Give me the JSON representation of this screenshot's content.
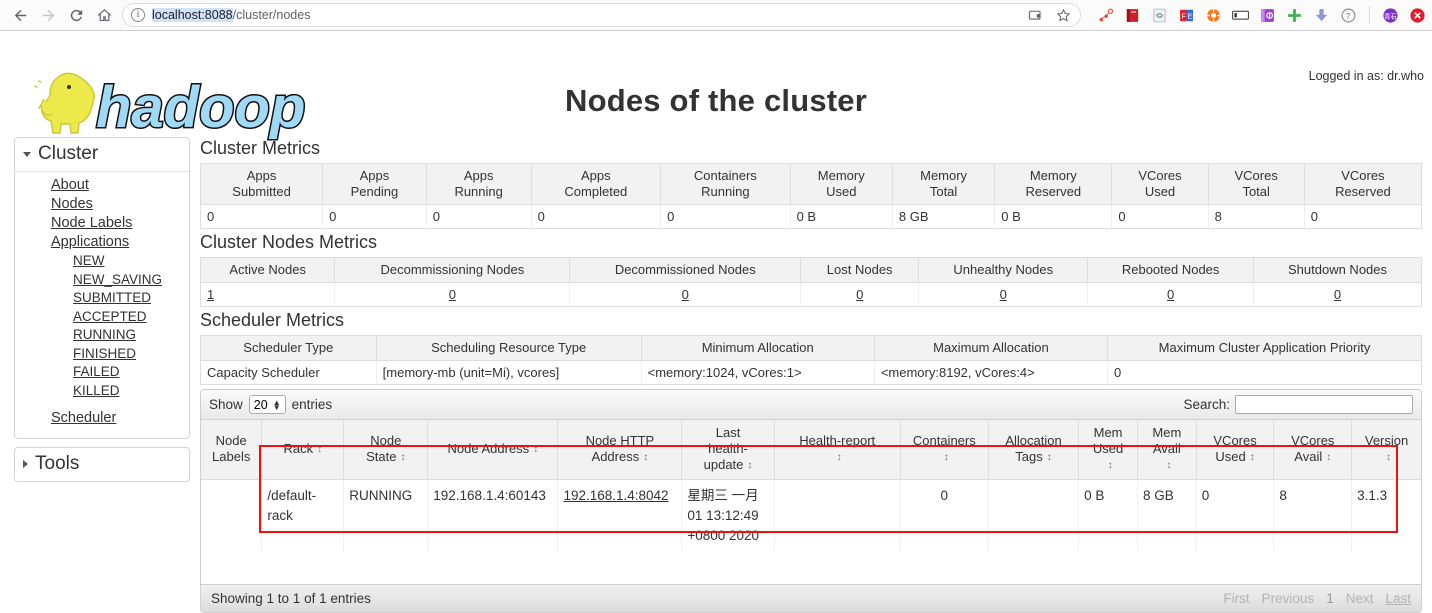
{
  "browser": {
    "back_icon": "back-arrow-icon",
    "forward_icon": "forward-arrow-icon",
    "reload_icon": "reload-icon",
    "home_icon": "home-icon",
    "info_icon": "info-circle-icon",
    "url_selected": "localhost:8088",
    "url_rest": "/cluster/nodes",
    "cast_icon": "cast-icon",
    "bookmark_icon": "star-icon",
    "extensions": [
      "network-graph-icon",
      "red-book-icon",
      "sync-page-icon",
      "fe-extension-icon",
      "orange-lifebuoy-icon",
      "input-box-icon",
      "purple-notebook-icon",
      "green-plus-icon",
      "download-arrow-icon",
      "clock-seven-icon",
      "qingshi-avatar-icon",
      "red-close-icon"
    ]
  },
  "header": {
    "logo_alt": "hadoop-logo",
    "logo_text": "hadoop",
    "title": "Nodes of the cluster",
    "logged_in": "Logged in as: dr.who"
  },
  "sidebar": {
    "cluster": {
      "label": "Cluster",
      "expanded": true,
      "items": [
        {
          "label": "About",
          "level": 1
        },
        {
          "label": "Nodes",
          "level": 1
        },
        {
          "label": "Node Labels",
          "level": 1
        },
        {
          "label": "Applications",
          "level": 1
        },
        {
          "label": "NEW",
          "level": 2
        },
        {
          "label": "NEW_SAVING",
          "level": 2
        },
        {
          "label": "SUBMITTED",
          "level": 2
        },
        {
          "label": "ACCEPTED",
          "level": 2
        },
        {
          "label": "RUNNING",
          "level": 2
        },
        {
          "label": "FINISHED",
          "level": 2
        },
        {
          "label": "FAILED",
          "level": 2
        },
        {
          "label": "KILLED",
          "level": 2
        },
        {
          "label": "Scheduler",
          "level": 1
        }
      ]
    },
    "tools": {
      "label": "Tools",
      "expanded": false
    }
  },
  "sections": {
    "cluster_metrics_title": "Cluster Metrics",
    "cluster_nodes_metrics_title": "Cluster Nodes Metrics",
    "scheduler_metrics_title": "Scheduler Metrics"
  },
  "cluster_metrics": {
    "headers": [
      "Apps\nSubmitted",
      "Apps\nPending",
      "Apps\nRunning",
      "Apps\nCompleted",
      "Containers\nRunning",
      "Memory\nUsed",
      "Memory\nTotal",
      "Memory\nReserved",
      "VCores\nUsed",
      "VCores\nTotal",
      "VCores\nReserved"
    ],
    "headers_l1": [
      "Apps",
      "Apps",
      "Apps",
      "Apps",
      "Containers",
      "Memory",
      "Memory",
      "Memory",
      "VCores",
      "VCores",
      "VCores"
    ],
    "headers_l2": [
      "Submitted",
      "Pending",
      "Running",
      "Completed",
      "Running",
      "Used",
      "Total",
      "Reserved",
      "Used",
      "Total",
      "Reserved"
    ],
    "values": [
      "0",
      "0",
      "0",
      "0",
      "0",
      "0 B",
      "8 GB",
      "0 B",
      "0",
      "8",
      "0"
    ]
  },
  "cluster_nodes_metrics": {
    "headers": [
      "Active Nodes",
      "Decommissioning Nodes",
      "Decommissioned Nodes",
      "Lost Nodes",
      "Unhealthy Nodes",
      "Rebooted Nodes",
      "Shutdown Nodes"
    ],
    "values": [
      "1",
      "0",
      "0",
      "0",
      "0",
      "0",
      "0"
    ]
  },
  "scheduler_metrics": {
    "headers": [
      "Scheduler Type",
      "Scheduling Resource Type",
      "Minimum Allocation",
      "Maximum Allocation",
      "Maximum Cluster Application Priority"
    ],
    "values": [
      "Capacity Scheduler",
      "[memory-mb (unit=Mi), vcores]",
      "<memory:1024, vCores:1>",
      "<memory:8192, vCores:4>",
      "0"
    ]
  },
  "datatable": {
    "show_label": "Show",
    "entries_label": "entries",
    "page_length": "20",
    "search_label": "Search:",
    "search_value": "",
    "search_placeholder": "",
    "columns": [
      {
        "l1": "Node",
        "l2": "Labels",
        "sortable": false
      },
      {
        "l1": "Rack",
        "l2": "",
        "sortable": true
      },
      {
        "l1": "Node",
        "l2": "State",
        "sortable": true
      },
      {
        "l1": "Node Address",
        "l2": "",
        "sortable": true
      },
      {
        "l1": "Node HTTP",
        "l2": "Address",
        "sortable": true
      },
      {
        "l1": "Last",
        "l2": "health-",
        "l3": "update",
        "sortable": true
      },
      {
        "l1": "Health-report",
        "l2": "",
        "sortable": true
      },
      {
        "l1": "Containers",
        "l2": "",
        "sortable": true
      },
      {
        "l1": "Allocation",
        "l2": "Tags",
        "sortable": true
      },
      {
        "l1": "Mem",
        "l2": "Used",
        "sortable": true
      },
      {
        "l1": "Mem",
        "l2": "Avail",
        "sortable": true
      },
      {
        "l1": "VCores",
        "l2": "Used",
        "sortable": true
      },
      {
        "l1": "VCores",
        "l2": "Avail",
        "sortable": true
      },
      {
        "l1": "Version",
        "l2": "",
        "sortable": true
      }
    ],
    "sort_icon": "sort-updown-icon",
    "rows": [
      {
        "node_labels": "",
        "rack": "/default-rack",
        "node_state": "RUNNING",
        "node_address": "192.168.1.4:60143",
        "node_http_address": "192.168.1.4:8042",
        "last_health_update": "星期三 一月 01 13:12:49 +0800 2020",
        "health_report": "",
        "containers": "0",
        "allocation_tags": "",
        "mem_used": "0 B",
        "mem_avail": "8 GB",
        "vcores_used": "0",
        "vcores_avail": "8",
        "version": "3.1.3"
      }
    ],
    "info": "Showing 1 to 1 of 1 entries",
    "pagination": [
      "First",
      "Previous",
      "1",
      "Next",
      "Last"
    ]
  },
  "annotation": {
    "shape": "red-rectangle-highlight",
    "color": "#ee1111"
  }
}
